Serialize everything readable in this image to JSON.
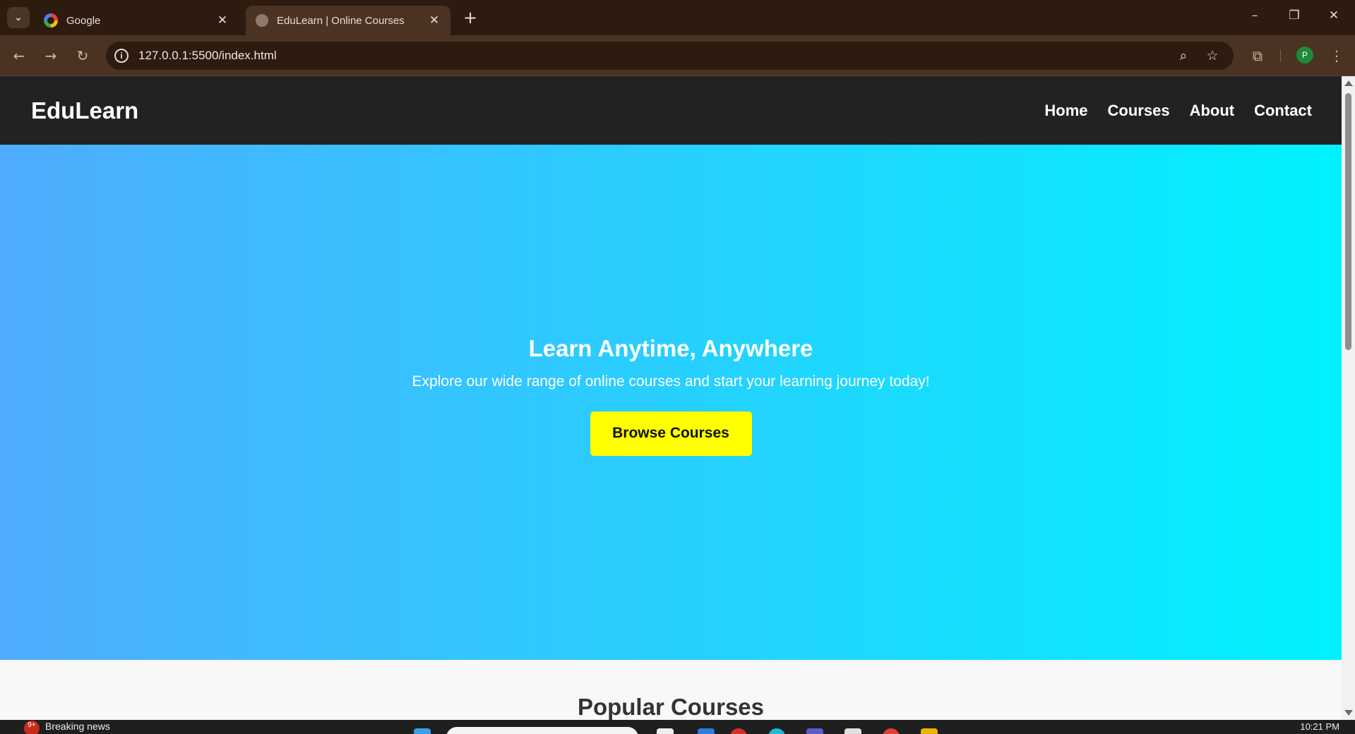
{
  "browser": {
    "tabs": [
      {
        "title": "Google",
        "active": false,
        "icon": "google-favicon-icon"
      },
      {
        "title": "EduLearn | Online Courses",
        "active": true,
        "icon": "globe-favicon-icon"
      }
    ],
    "url": "127.0.0.1:5500/index.html",
    "profile_initial": "P"
  },
  "site": {
    "brand": "EduLearn",
    "nav": [
      "Home",
      "Courses",
      "About",
      "Contact"
    ],
    "hero": {
      "heading": "Learn Anytime, Anywhere",
      "subheading": "Explore our wide range of online courses and start your learning journey today!",
      "cta_label": "Browse Courses",
      "gradient_start": "#4facfe",
      "gradient_end": "#00f2fe",
      "cta_color": "#ffff00"
    },
    "next_section_title": "Popular Courses"
  },
  "taskbar": {
    "news_badge": "9+",
    "news_label": "Breaking news",
    "clock": "10:21 PM"
  }
}
